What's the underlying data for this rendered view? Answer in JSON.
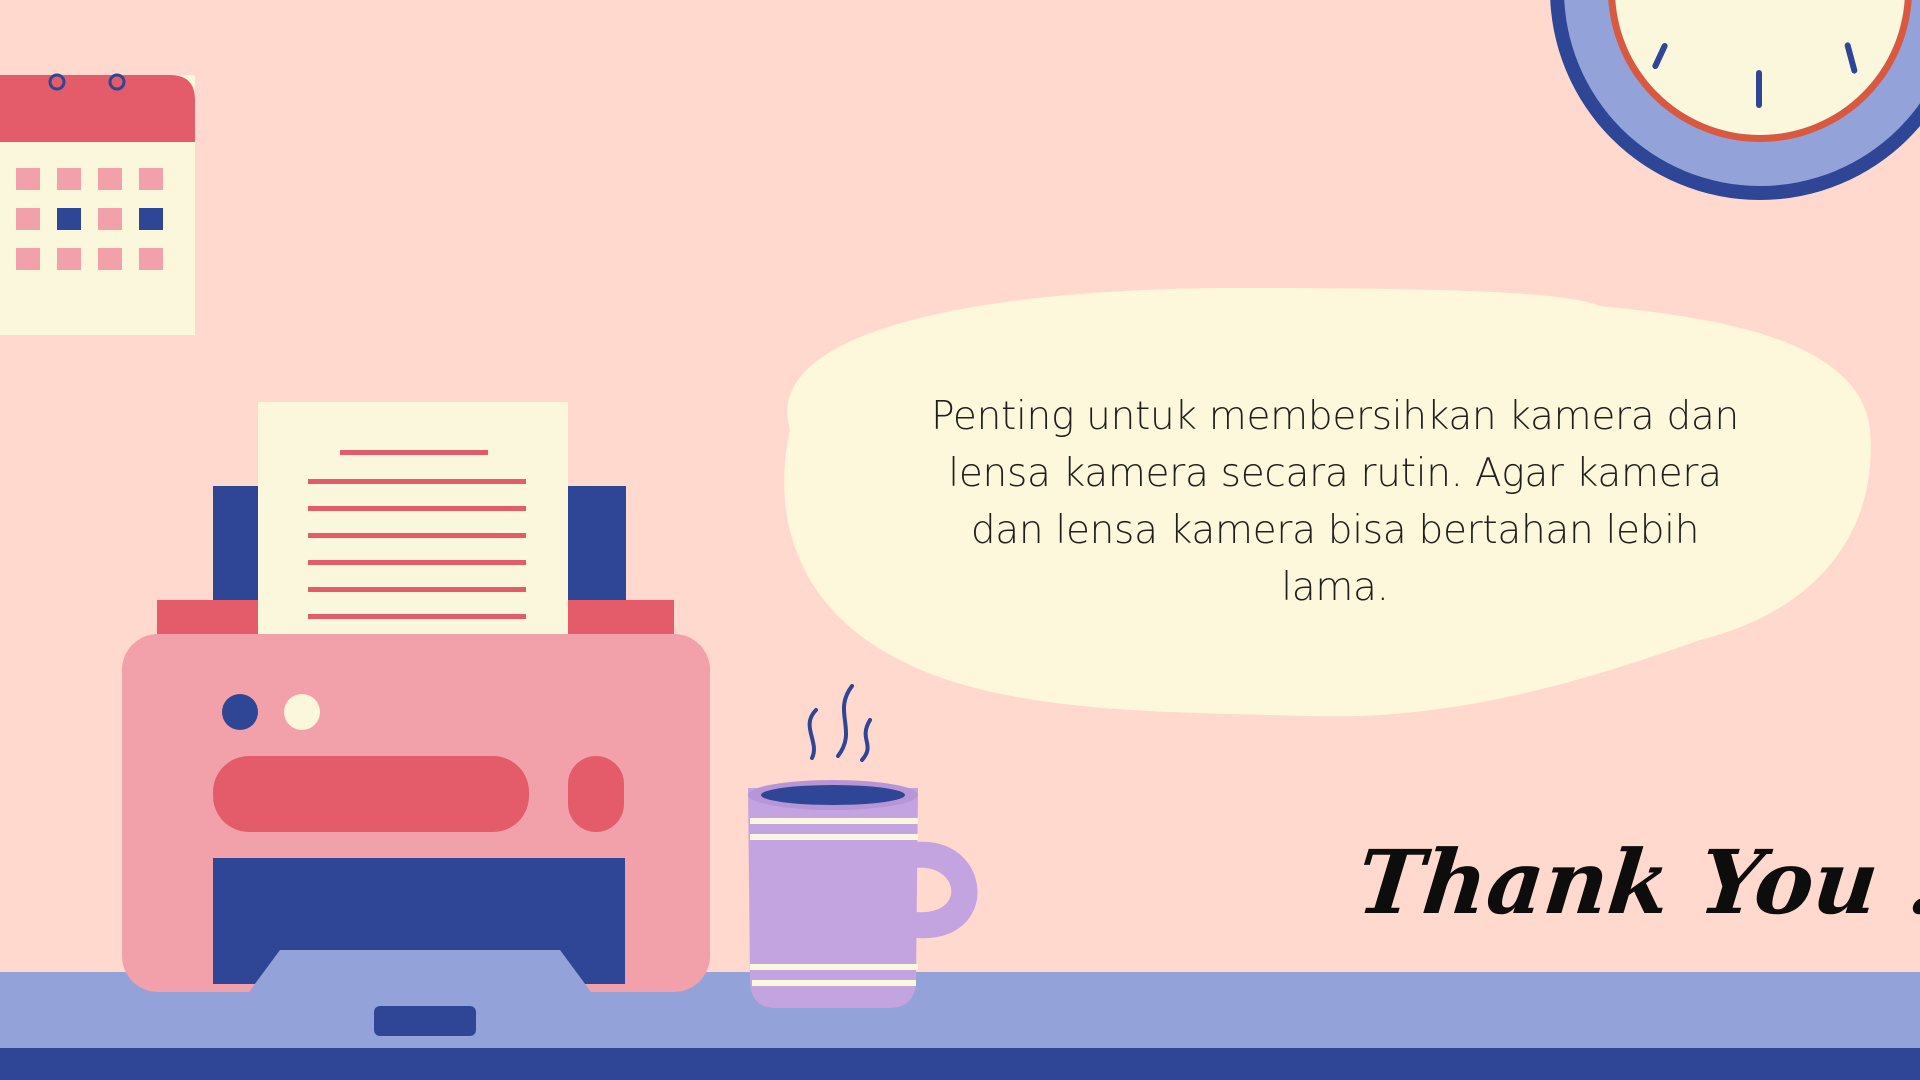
{
  "slide": {
    "message": "Penting untuk membersihkan kamera dan lensa kamera secara rutin. Agar kamera dan lensa kamera bisa bertahan lebih lama.",
    "closing": "Thank You .."
  },
  "illustration": {
    "icons": [
      "calendar-icon",
      "wall-clock-icon",
      "printer-icon",
      "coffee-mug-icon",
      "steam-icon"
    ],
    "colors": {
      "background": "#FFD9CD",
      "speech_bubble": "#FDF8DB",
      "desk_top": "#93A3D9",
      "desk_base": "#2E4695",
      "printer_body": "#F2A0AA",
      "accent_red": "#E45C6A",
      "navy": "#2E4695",
      "paper": "#FBF7DC",
      "mug": "#C4A4E0"
    }
  }
}
